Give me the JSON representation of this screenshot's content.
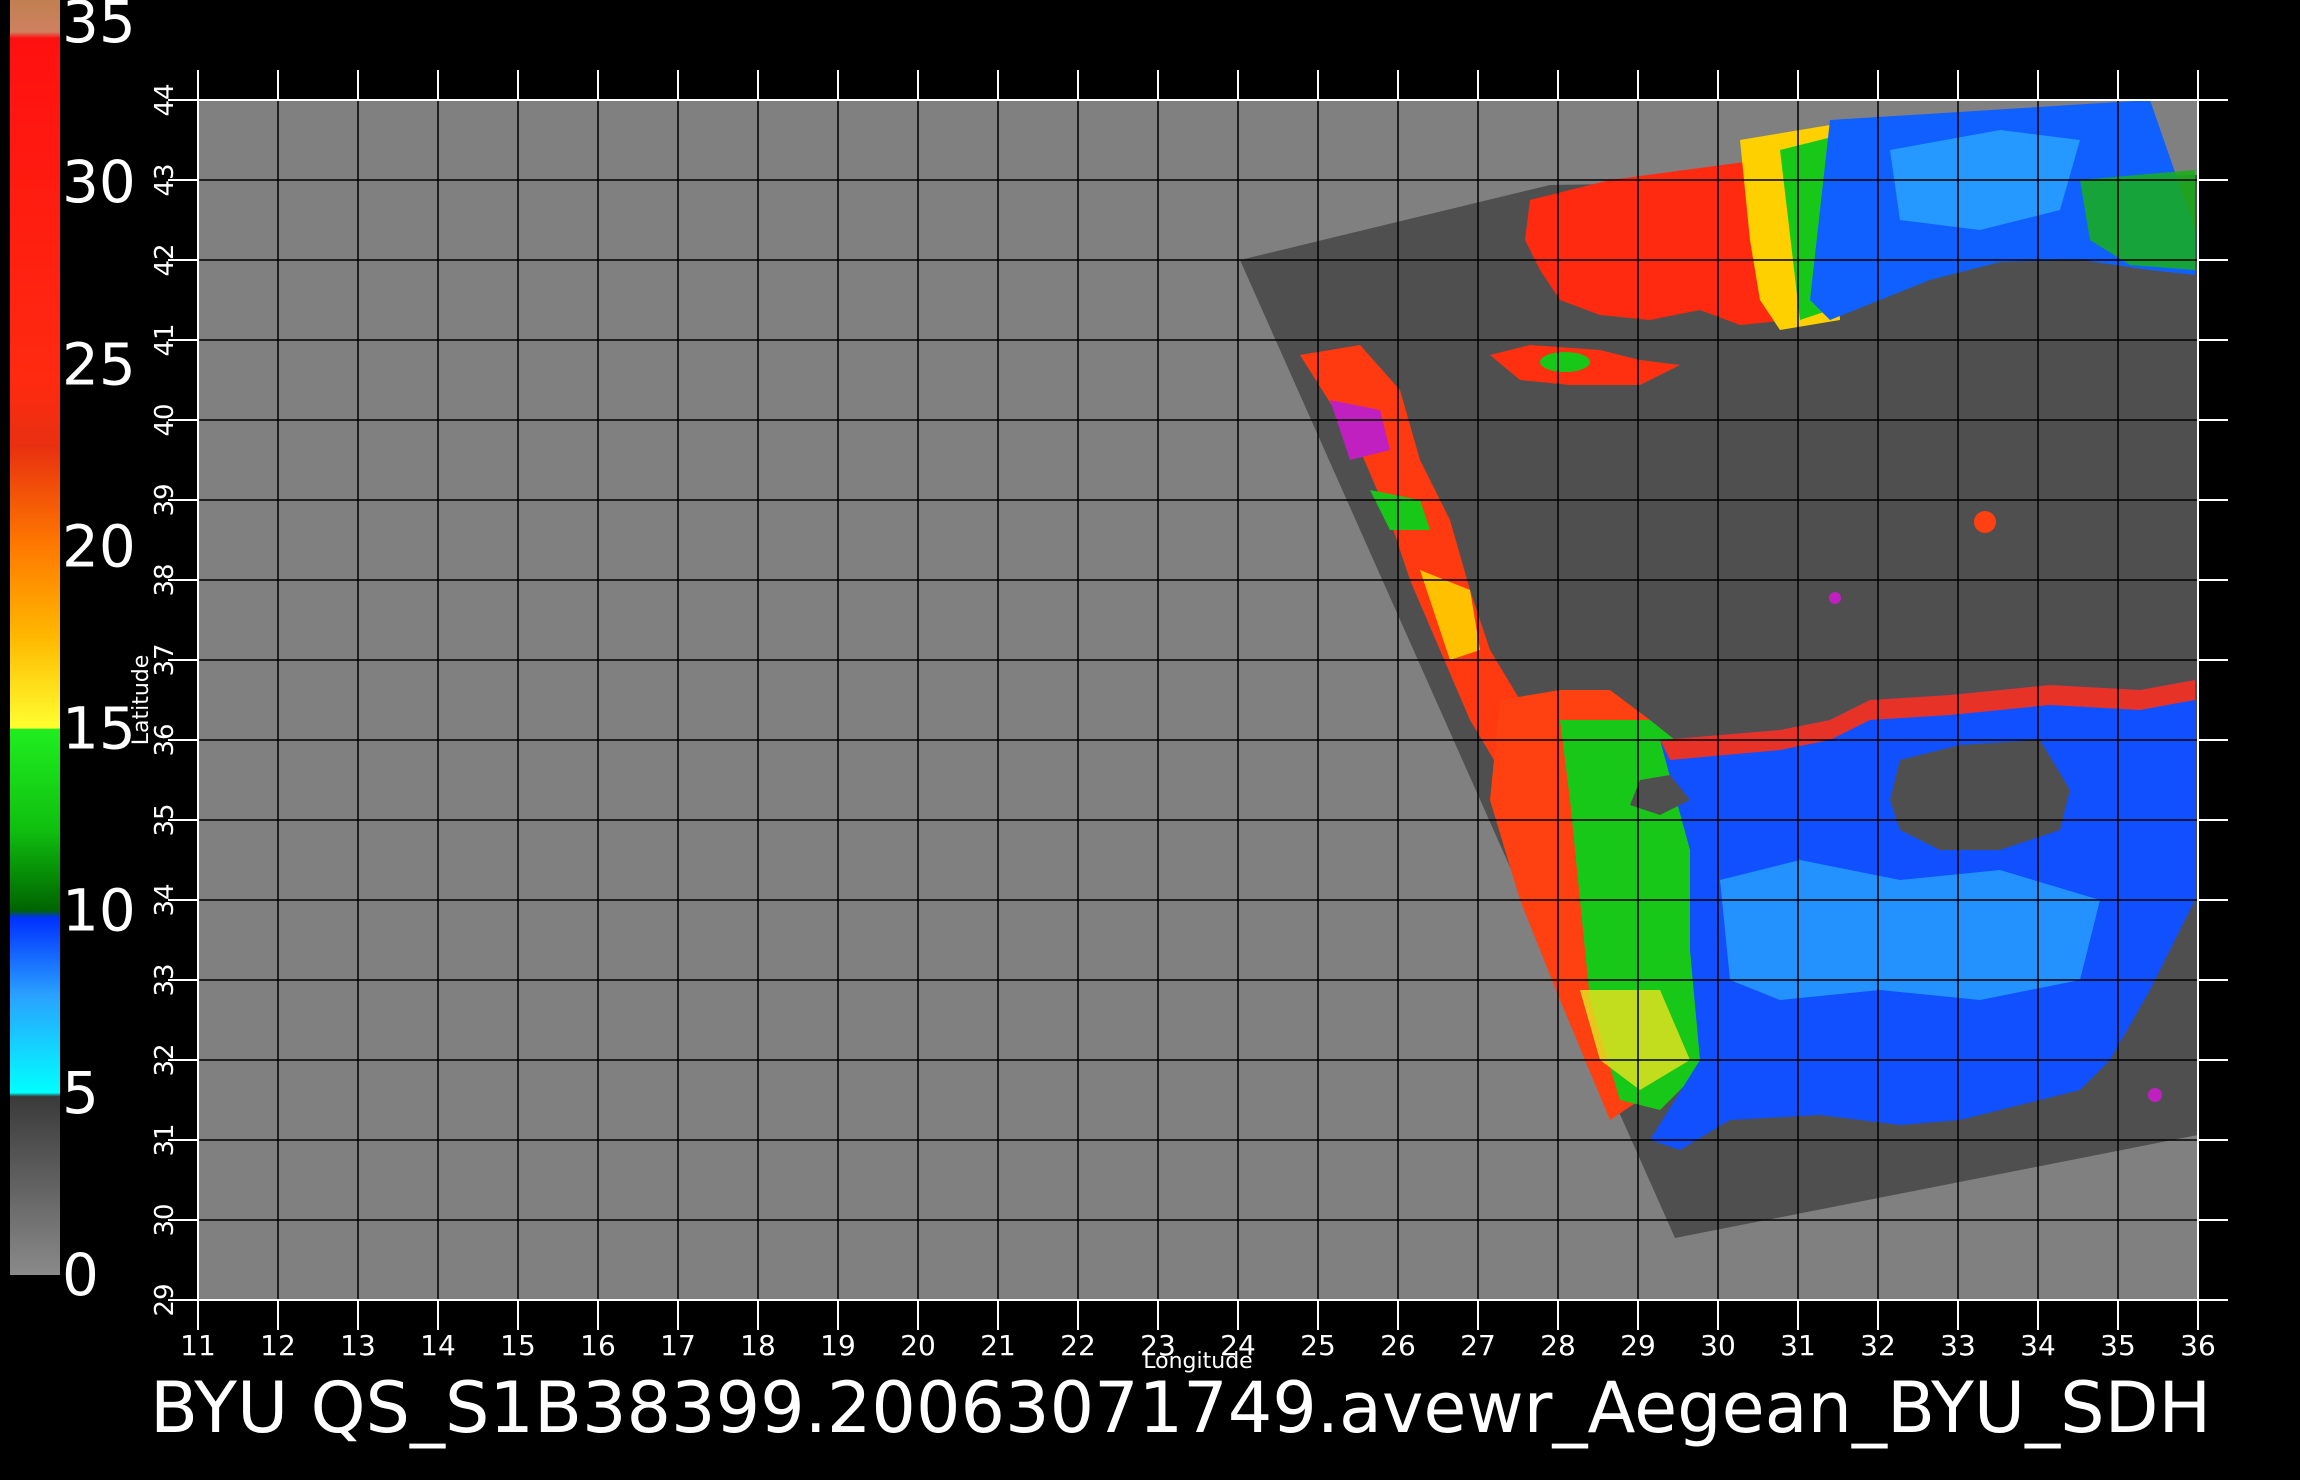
{
  "colorbar": {
    "labels": [
      "35",
      "30",
      "25",
      "20",
      "15",
      "10",
      "5",
      "0"
    ],
    "value_range": [
      0,
      35
    ]
  },
  "axes": {
    "xlabel": "Longitude",
    "ylabel": "Latitude",
    "xlim": [
      11,
      36
    ],
    "ylim": [
      29,
      44
    ],
    "x_ticks": [
      "11",
      "12",
      "13",
      "14",
      "15",
      "16",
      "17",
      "18",
      "19",
      "20",
      "21",
      "22",
      "23",
      "24",
      "25",
      "26",
      "27",
      "28",
      "29",
      "30",
      "31",
      "32",
      "33",
      "34",
      "35",
      "36"
    ],
    "y_ticks": [
      "29",
      "30",
      "31",
      "32",
      "33",
      "34",
      "35",
      "36",
      "37",
      "38",
      "39",
      "40",
      "41",
      "42",
      "43",
      "44"
    ]
  },
  "title": "BYU  QS_S1B38399.20063071749.avewr_Aegean_BYU_SDH",
  "colors": {
    "land_gray": "#808080",
    "swath_dark_gray": "#4f4f4f",
    "background": "#000000",
    "grid": "#000000",
    "tick": "#ffffff"
  }
}
